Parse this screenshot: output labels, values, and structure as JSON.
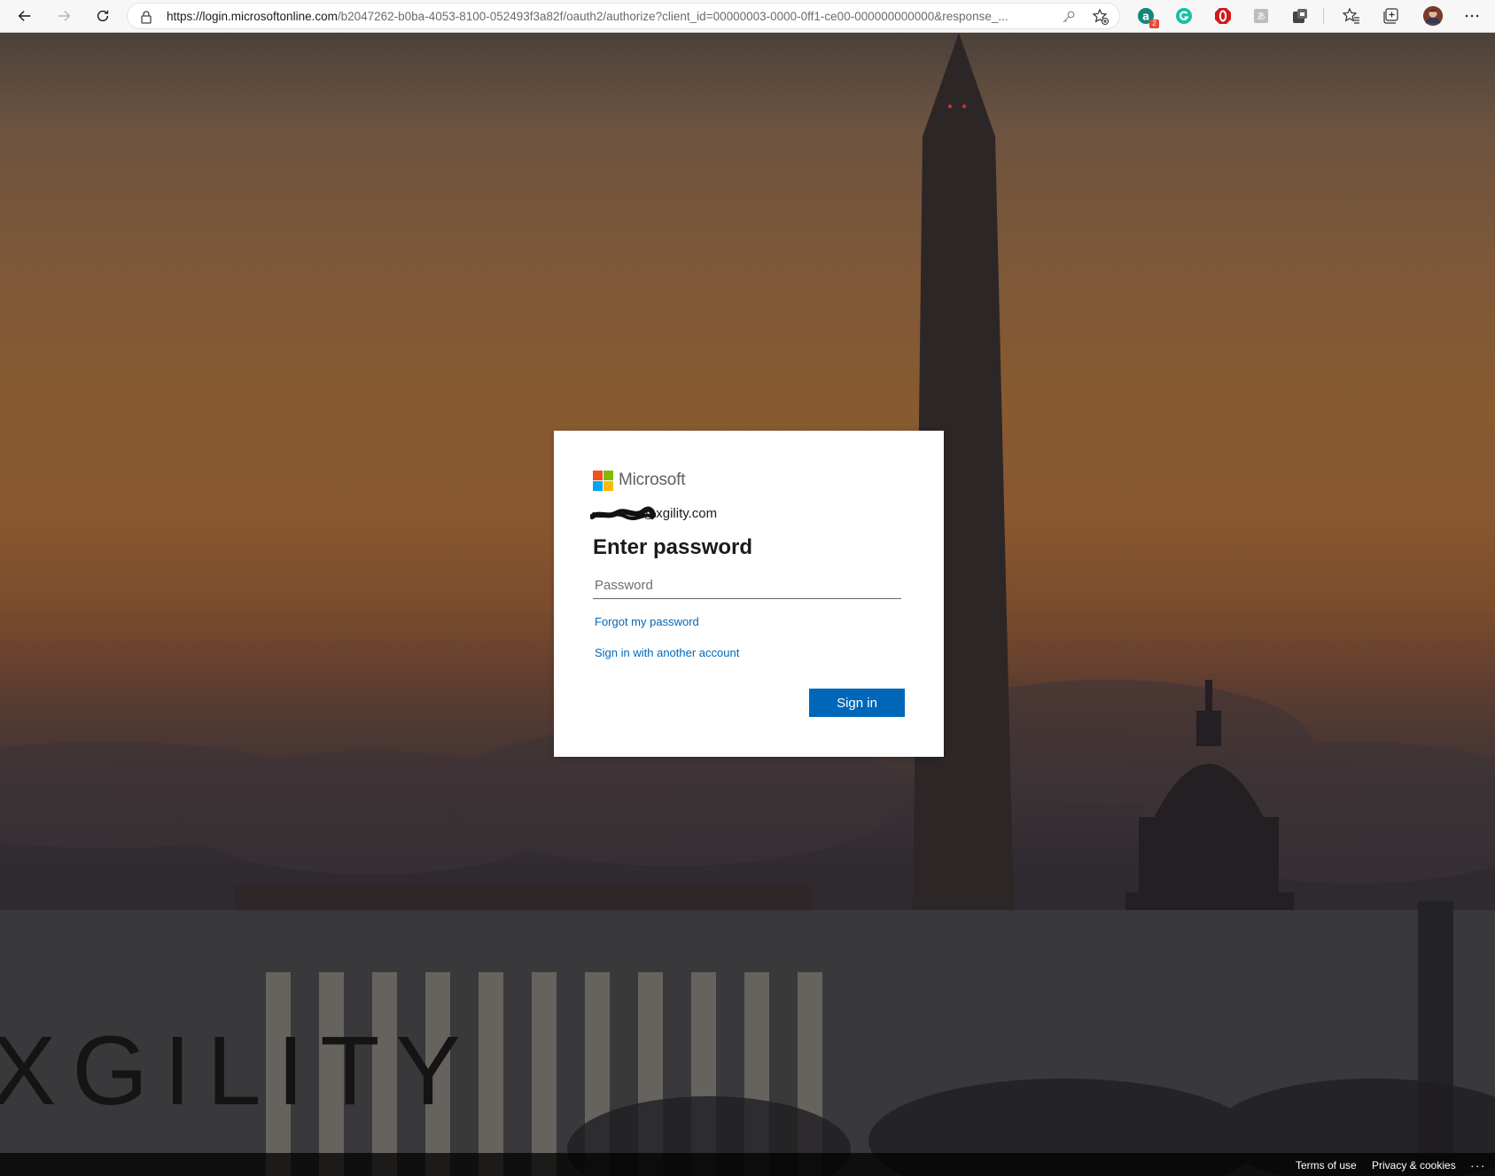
{
  "browser": {
    "url_host": "https://login.microsoftonline.com",
    "url_rest": "/b2047262-b0ba-4053-8100-052493f3a82f/oauth2/authorize?client_id=00000003-0000-0ff1-ce00-000000000000&response_...",
    "extension_badge": "2"
  },
  "page": {
    "watermark": "XGILITY"
  },
  "card": {
    "brand": "Microsoft",
    "email_suffix": "@xgility.com",
    "title": "Enter password",
    "password_placeholder": "Password",
    "forgot_link": "Forgot my password",
    "another_account_link": "Sign in with another account",
    "signin_button": "Sign in"
  },
  "footer": {
    "terms": "Terms of use",
    "privacy": "Privacy & cookies",
    "more": "..."
  },
  "icons": {
    "back": "back-arrow-icon",
    "forward": "forward-arrow-icon",
    "refresh": "refresh-icon",
    "lock": "lock-icon",
    "key": "key-icon",
    "favorite_add": "favorite-add-icon",
    "favorites": "favorites-icon",
    "collections": "collections-icon",
    "menu": "more-menu-icon"
  },
  "colors": {
    "primary_button": "#0067b8",
    "link": "#0067b8",
    "ms_red": "#f25022",
    "ms_green": "#7fba00",
    "ms_blue": "#00a4ef",
    "ms_yellow": "#ffb900"
  }
}
